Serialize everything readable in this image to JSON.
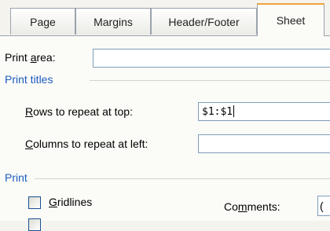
{
  "tabs": [
    {
      "label": "Page"
    },
    {
      "label": "Margins"
    },
    {
      "label": "Header/Footer"
    },
    {
      "label": "Sheet",
      "active": true
    }
  ],
  "print_area": {
    "label_pre": "Print ",
    "label_key": "a",
    "label_post": "rea:",
    "value": ""
  },
  "print_titles": {
    "heading": "Print titles",
    "rows": {
      "label_key": "R",
      "label_post": "ows to repeat at top:",
      "value": "$1:$1"
    },
    "columns": {
      "label_key": "C",
      "label_post": "olumns to repeat at left:",
      "value": ""
    }
  },
  "print": {
    "heading": "Print",
    "gridlines": {
      "label_key": "G",
      "label_post": "ridlines",
      "checked": false
    },
    "comments": {
      "label_pre": "Co",
      "label_key": "m",
      "label_post": "ments:",
      "value": "("
    }
  }
}
